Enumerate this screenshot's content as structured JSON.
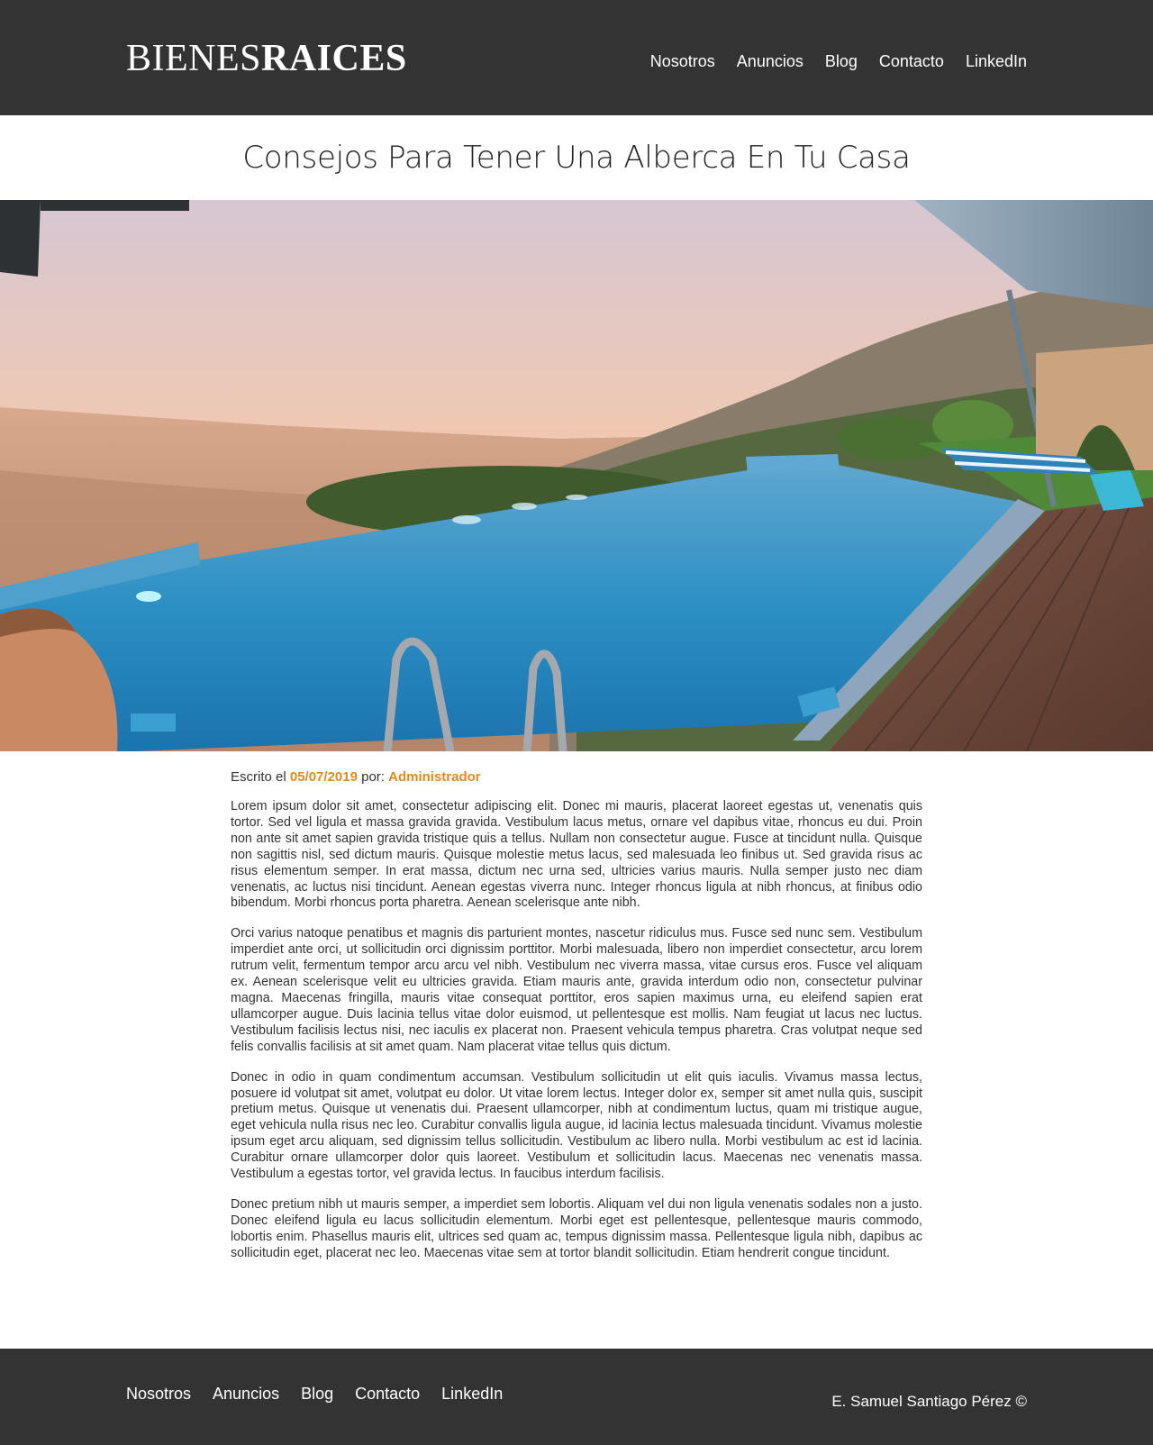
{
  "header": {
    "logo_thin": "BIENES",
    "logo_bold": "RAICES",
    "nav": [
      "Nosotros",
      "Anuncios",
      "Blog",
      "Contacto",
      "LinkedIn"
    ]
  },
  "article": {
    "title": "Consejos Para Tener Una Alberca En Tu Casa",
    "meta_prefix": "Escrito el ",
    "date": "05/07/2019",
    "meta_by": " por: ",
    "author": "Administrador",
    "paragraphs": [
      "Lorem ipsum dolor sit amet, consectetur adipiscing elit. Donec mi mauris, placerat laoreet egestas ut, venenatis quis tortor. Sed vel ligula et massa gravida gravida. Vestibulum lacus metus, ornare vel dapibus vitae, rhoncus eu dui. Proin non ante sit amet sapien gravida tristique quis a tellus. Nullam non consectetur augue. Fusce at tincidunt nulla. Quisque non sagittis nisl, sed dictum mauris. Quisque molestie metus lacus, sed malesuada leo finibus ut. Sed gravida risus ac risus elementum semper. In erat massa, dictum nec urna sed, ultricies varius mauris. Nulla semper justo nec diam venenatis, ac luctus nisi tincidunt. Aenean egestas viverra nunc. Integer rhoncus ligula at nibh rhoncus, at finibus odio bibendum. Morbi rhoncus porta pharetra. Aenean scelerisque ante nibh.",
      "Orci varius natoque penatibus et magnis dis parturient montes, nascetur ridiculus mus. Fusce sed nunc sem. Vestibulum imperdiet ante orci, ut sollicitudin orci dignissim porttitor. Morbi malesuada, libero non imperdiet consectetur, arcu lorem rutrum velit, fermentum tempor arcu arcu vel nibh. Vestibulum nec viverra massa, vitae cursus eros. Fusce vel aliquam ex. Aenean scelerisque velit eu ultricies gravida. Etiam mauris ante, gravida interdum odio non, consectetur pulvinar magna. Maecenas fringilla, mauris vitae consequat porttitor, eros sapien maximus urna, eu eleifend sapien erat ullamcorper augue. Duis lacinia tellus vitae dolor euismod, ut pellentesque est mollis. Nam feugiat ut lacus nec luctus. Vestibulum facilisis lectus nisi, nec iaculis ex placerat non. Praesent vehicula tempus pharetra. Cras volutpat neque sed felis convallis facilisis at sit amet quam. Nam placerat vitae tellus quis dictum.",
      "Donec in odio in quam condimentum accumsan. Vestibulum sollicitudin ut elit quis iaculis. Vivamus massa lectus, posuere id volutpat sit amet, volutpat eu dolor. Ut vitae lorem lectus. Integer dolor ex, semper sit amet nulla quis, suscipit pretium metus. Quisque ut venenatis dui. Praesent ullamcorper, nibh at condimentum luctus, quam mi tristique augue, eget vehicula nulla risus nec leo. Curabitur convallis ligula augue, id lacinia lectus malesuada tincidunt. Vivamus molestie ipsum eget arcu aliquam, sed dignissim tellus sollicitudin. Vestibulum ac libero nulla. Morbi vestibulum ac est id lacinia. Curabitur ornare ullamcorper dolor quis laoreet. Vestibulum et sollicitudin lacus. Maecenas nec venenatis massa. Vestibulum a egestas tortor, vel gravida lectus. In faucibus interdum facilisis.",
      "Donec pretium nibh ut mauris semper, a imperdiet sem lobortis. Aliquam vel dui non ligula venenatis sodales non a justo. Donec eleifend ligula eu lacus sollicitudin elementum. Morbi eget est pellentesque, pellentesque mauris commodo, lobortis enim. Phasellus mauris elit, ultrices sed quam ac, tempus dignissim massa. Pellentesque ligula nibh, dapibus ac sollicitudin eget, placerat nec leo. Maecenas vitae sem at tortor blandit sollicitudin. Etiam hendrerit congue tincidunt."
    ]
  },
  "footer": {
    "nav": [
      "Nosotros",
      "Anuncios",
      "Blog",
      "Contacto",
      "LinkedIn"
    ],
    "copyright": "E. Samuel Santiago Pérez ©"
  },
  "colors": {
    "bar": "#333333",
    "accent": "#e08a1e"
  }
}
